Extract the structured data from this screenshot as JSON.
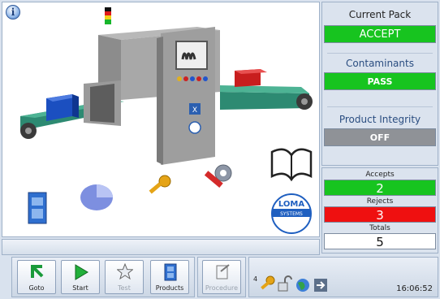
{
  "right_panel": {
    "current_pack_title": "Current Pack",
    "current_pack_value": "ACCEPT",
    "contaminants_title": "Contaminants",
    "contaminants_value": "PASS",
    "integrity_title": "Product Integrity",
    "integrity_value": "OFF"
  },
  "counts": {
    "accepts_label": "Accepts",
    "accepts_value": "2",
    "rejects_label": "Rejects",
    "rejects_value": "3",
    "totals_label": "Totals",
    "totals_value": "5"
  },
  "scene": {
    "machine_badge": "X",
    "logo_line1": "LOMA",
    "logo_line2": "SYSTEMS"
  },
  "toolbar": {
    "goto": "Goto",
    "start": "Start",
    "test": "Test",
    "products": "Products",
    "procedure": "Procedure",
    "access_level": "4",
    "clock": "16:06:52"
  },
  "colors": {
    "accept_green": "#17c41f",
    "reject_red": "#ef1010",
    "off_grey": "#8f9297"
  }
}
